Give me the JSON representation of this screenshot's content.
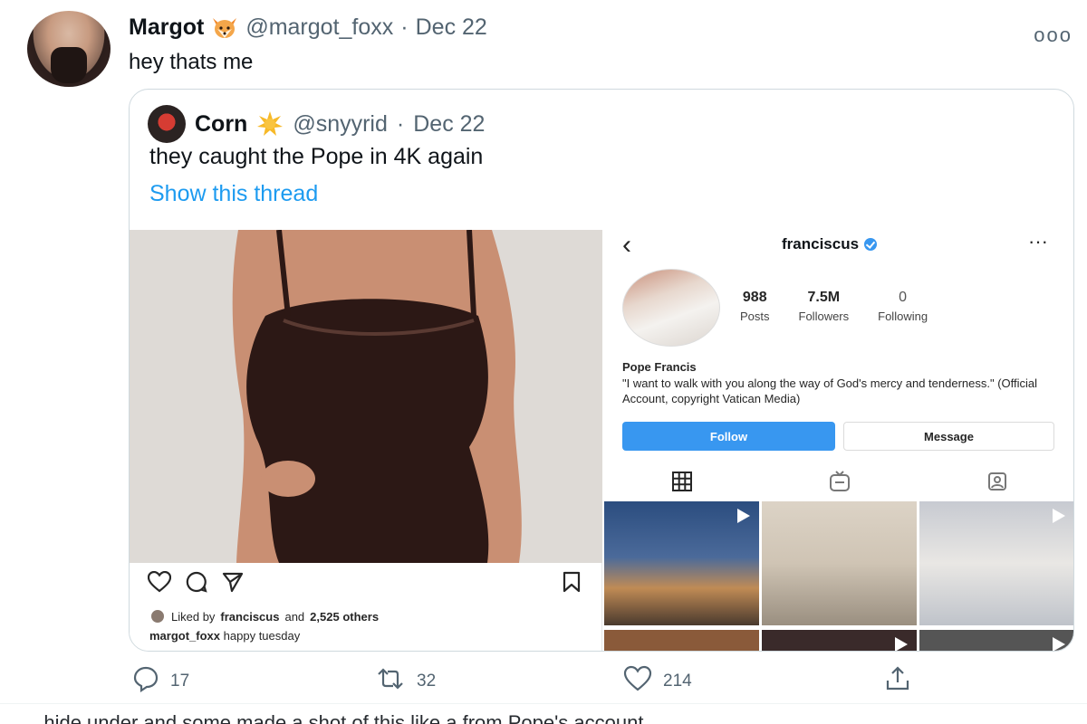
{
  "tweet": {
    "display_name": "Margot",
    "handle": "@margot_foxx",
    "separator": "·",
    "date": "Dec 22",
    "text": "hey thats me",
    "more_icon": "more-horizontal-icon"
  },
  "quote": {
    "display_name": "Corn",
    "handle": "@snyyrid",
    "separator": "·",
    "date": "Dec 22",
    "text": "they caught the Pope in 4K again",
    "show_thread": "Show this thread"
  },
  "ig_post": {
    "liked_by_prefix": "Liked by",
    "liked_by_user": "franciscus",
    "liked_by_and": "and",
    "liked_by_count": "2,525 others",
    "caption_user": "margot_foxx",
    "caption_text": "happy tuesday"
  },
  "ig_profile": {
    "username": "franciscus",
    "stats": [
      {
        "value": "988",
        "label": "Posts"
      },
      {
        "value": "7.5M",
        "label": "Followers"
      },
      {
        "value": "0",
        "label": "Following"
      }
    ],
    "name": "Pope Francis",
    "bio": "\"I want to walk with you along the way of God's mercy and tenderness.\" (Official Account, copyright Vatican Media)",
    "follow_label": "Follow",
    "message_label": "Message",
    "accent_color": "#3897f0"
  },
  "actions": {
    "replies": "17",
    "retweets": "32",
    "likes": "214"
  },
  "footer": {
    "text": "...hide under and some made a shot of this like a from Pope's account"
  },
  "colors": {
    "link": "#1d9bf0",
    "muted": "#536471",
    "border": "#cfd9de"
  }
}
